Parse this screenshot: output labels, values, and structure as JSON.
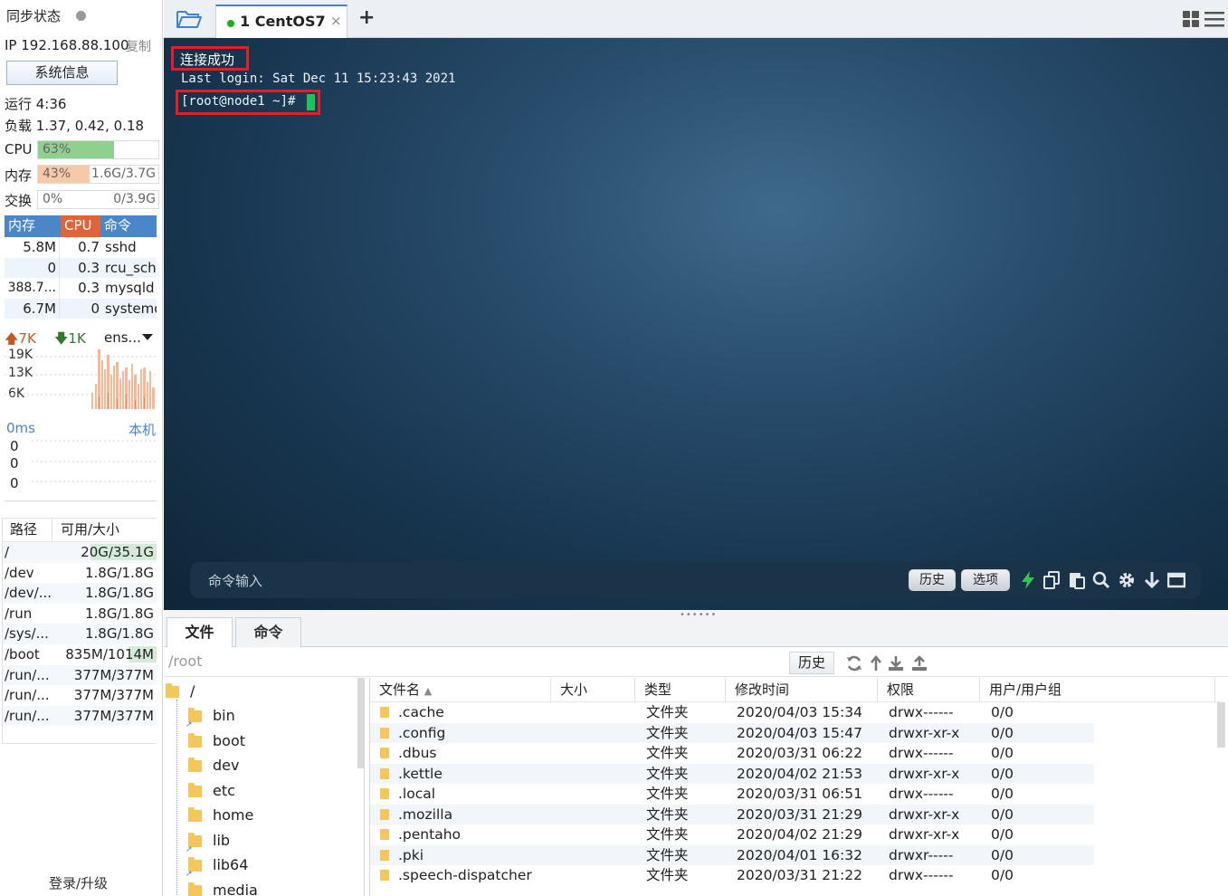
{
  "sidebar": {
    "sync_status": "同步状态",
    "ip_label": "IP 192.168.88.100",
    "copy": "复制",
    "sysinfo_button": "系统信息",
    "uptime": "运行 4:36",
    "load": "负载 1.37, 0.42, 0.18",
    "meters": {
      "cpu": {
        "label": "CPU",
        "pct": "63%",
        "value": "",
        "fill_fraction": 0.63,
        "color": "#8fd08f"
      },
      "mem": {
        "label": "内存",
        "pct": "43%",
        "value": "1.6G/3.7G",
        "fill_fraction": 0.43,
        "color": "#f8c9a8"
      },
      "swap": {
        "label": "交换",
        "pct": "0%",
        "value": "0/3.9G",
        "fill_fraction": 0.0,
        "color": "#cfe3f5"
      }
    },
    "process_table": {
      "headers": {
        "mem": "内存",
        "cpu": "CPU",
        "cmd": "命令"
      },
      "rows": [
        {
          "mem": "5.8M",
          "cpu": "0.7",
          "cmd": "sshd"
        },
        {
          "mem": "0",
          "cpu": "0.3",
          "cmd": "rcu_sche"
        },
        {
          "mem": "388.7...",
          "cpu": "0.3",
          "cmd": "mysqld"
        },
        {
          "mem": "6.7M",
          "cpu": "0",
          "cmd": "systemd"
        }
      ]
    },
    "network": {
      "up": "7K",
      "down": "1K",
      "interface": "ens...",
      "ticks": [
        "19K",
        "13K",
        "6K"
      ]
    },
    "ping": {
      "latency": "0ms",
      "host": "本机",
      "values": [
        "0",
        "0",
        "0"
      ]
    },
    "disks": {
      "headers": {
        "path": "路径",
        "size": "可用/大小"
      },
      "rows": [
        {
          "path": "/",
          "size": "20G/35.1G",
          "used_fraction": 0.43
        },
        {
          "path": "/dev",
          "size": "1.8G/1.8G",
          "used_fraction": 0.0
        },
        {
          "path": "/dev/...",
          "size": "1.8G/1.8G",
          "used_fraction": 0.0
        },
        {
          "path": "/run",
          "size": "1.8G/1.8G",
          "used_fraction": 0.0
        },
        {
          "path": "/sys/...",
          "size": "1.8G/1.8G",
          "used_fraction": 0.0
        },
        {
          "path": "/boot",
          "size": "835M/1014M",
          "used_fraction": 0.18
        },
        {
          "path": "/run/...",
          "size": "377M/377M",
          "used_fraction": 0.0
        },
        {
          "path": "/run/...",
          "size": "377M/377M",
          "used_fraction": 0.0
        },
        {
          "path": "/run/...",
          "size": "377M/377M",
          "used_fraction": 0.0
        }
      ]
    },
    "login_upgrade": "登录/升级"
  },
  "tabs": {
    "active_tab": "1 CentOS7",
    "close_symbol": "×",
    "add_symbol": "+"
  },
  "terminal": {
    "connection_message": "连接成功",
    "last_login": "Last login: Sat Dec 11 15:23:43 2021",
    "prompt": "[root@node1 ~]# ",
    "command_placeholder": "命令输入",
    "history_button": "历史",
    "options_button": "选项"
  },
  "bottom_tabs": {
    "files": "文件",
    "commands": "命令"
  },
  "pathbar": {
    "path": "/root",
    "history_button": "历史"
  },
  "tree": {
    "root": "/",
    "items": [
      "bin",
      "boot",
      "dev",
      "etc",
      "home",
      "lib",
      "lib64",
      "media"
    ]
  },
  "filelist": {
    "headers": {
      "name": "文件名",
      "size": "大小",
      "type": "类型",
      "mtime": "修改时间",
      "perm": "权限",
      "owner": "用户/用户组"
    },
    "rows": [
      {
        "name": ".cache",
        "size": "",
        "type": "文件夹",
        "mtime": "2020/04/03 15:34",
        "perm": "drwx------",
        "owner": "0/0"
      },
      {
        "name": ".config",
        "size": "",
        "type": "文件夹",
        "mtime": "2020/04/03 15:47",
        "perm": "drwxr-xr-x",
        "owner": "0/0"
      },
      {
        "name": ".dbus",
        "size": "",
        "type": "文件夹",
        "mtime": "2020/03/31 06:22",
        "perm": "drwx------",
        "owner": "0/0"
      },
      {
        "name": ".kettle",
        "size": "",
        "type": "文件夹",
        "mtime": "2020/04/02 21:53",
        "perm": "drwxr-xr-x",
        "owner": "0/0"
      },
      {
        "name": ".local",
        "size": "",
        "type": "文件夹",
        "mtime": "2020/03/31 06:51",
        "perm": "drwx------",
        "owner": "0/0"
      },
      {
        "name": ".mozilla",
        "size": "",
        "type": "文件夹",
        "mtime": "2020/03/31 21:29",
        "perm": "drwxr-xr-x",
        "owner": "0/0"
      },
      {
        "name": ".pentaho",
        "size": "",
        "type": "文件夹",
        "mtime": "2020/04/02 21:29",
        "perm": "drwxr-xr-x",
        "owner": "0/0"
      },
      {
        "name": ".pki",
        "size": "",
        "type": "文件夹",
        "mtime": "2020/04/01 16:32",
        "perm": "drwxr-----",
        "owner": "0/0"
      },
      {
        "name": ".speech-dispatcher",
        "size": "",
        "type": "文件夹",
        "mtime": "2020/03/31 21:22",
        "perm": "drwx------",
        "owner": "0/0"
      }
    ]
  },
  "colors": {
    "accent": "#3c83d6",
    "highlight_box": "#e21f26",
    "cursor": "#1bc45c",
    "connected_dot": "#19b319"
  }
}
